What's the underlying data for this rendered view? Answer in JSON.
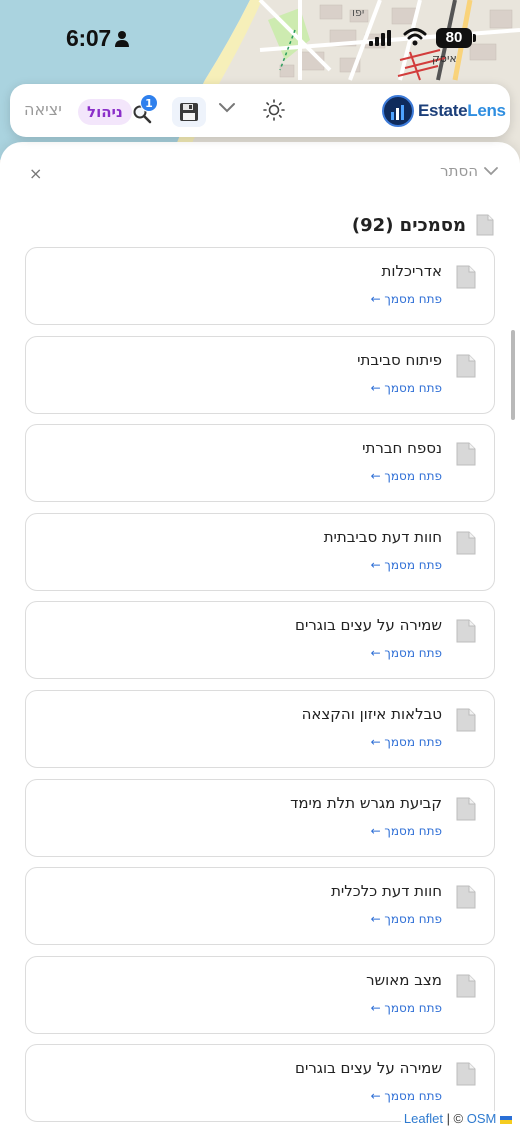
{
  "status_bar": {
    "time": "6:07",
    "battery": "80"
  },
  "toolbar": {
    "logout_label": "יציאה",
    "admin_label": "ניהול",
    "search_badge": "1",
    "logo_estate": "Estate",
    "logo_lens": "Lens"
  },
  "icons": {
    "search": "magnifier-icon",
    "save": "floppy-disk-icon",
    "theme": "sun-icon",
    "expand": "chevron-down-icon",
    "document": "document-icon",
    "close": "close-icon",
    "user": "person-icon"
  },
  "map": {
    "labels": [
      "יפו",
      "איסק"
    ]
  },
  "panel": {
    "close_label": "×",
    "hide_label": "הסתר",
    "title": "מסמכים (92)",
    "documents": [
      {
        "title": "אדריכלות",
        "link": "פתח מסמך ←"
      },
      {
        "title": "פיתוח סביבתי",
        "link": "פתח מסמך ←"
      },
      {
        "title": "נספח חברתי",
        "link": "פתח מסמך ←"
      },
      {
        "title": "חוות דעת סביבתית",
        "link": "פתח מסמך ←"
      },
      {
        "title": "שמירה על עצים בוגרים",
        "link": "פתח מסמך ←"
      },
      {
        "title": "טבלאות איזון והקצאה",
        "link": "פתח מסמך ←"
      },
      {
        "title": "קביעת מגרש תלת מימד",
        "link": "פתח מסמך ←"
      },
      {
        "title": "חוות דעת כלכלית",
        "link": "פתח מסמך ←"
      },
      {
        "title": "מצב מאושר",
        "link": "פתח מסמך ←"
      },
      {
        "title": "שמירה על עצים בוגרים",
        "link": "פתח מסמך ←"
      }
    ]
  },
  "attribution": {
    "leaflet": "Leaflet",
    "separator": " | © ",
    "osm": "OSM"
  },
  "colors": {
    "accent_blue": "#2f6fd6",
    "admin_purple": "#8b2fc9",
    "admin_bg": "#f3e6fb",
    "badge_blue": "#2f80ed",
    "logo_navy": "#1c3f7a",
    "logo_sky": "#2f8ee0"
  }
}
